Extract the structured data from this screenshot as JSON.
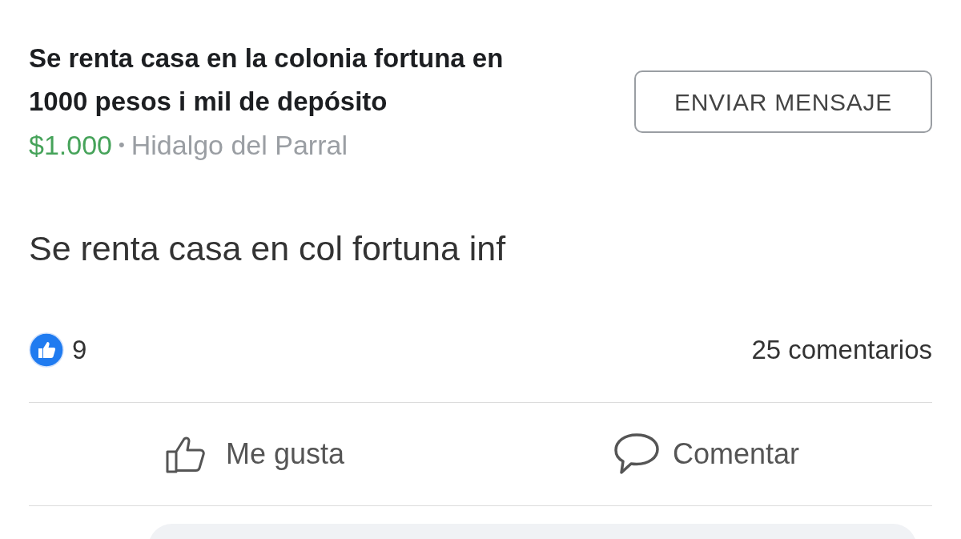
{
  "listing": {
    "title": "Se renta casa en la colonia fortuna en 1000 pesos i mil de depósito",
    "price": "$1.000",
    "separator": "•",
    "location": "Hidalgo del Parral",
    "button": "ENVIAR MENSAJE"
  },
  "post_text": "Se renta casa en col fortuna inf",
  "reactions": {
    "count": "9",
    "comments": "25 comentarios"
  },
  "actions": [
    {
      "kind": "like",
      "label": "Me gusta"
    },
    {
      "kind": "comment",
      "label": "Comentar"
    }
  ]
}
